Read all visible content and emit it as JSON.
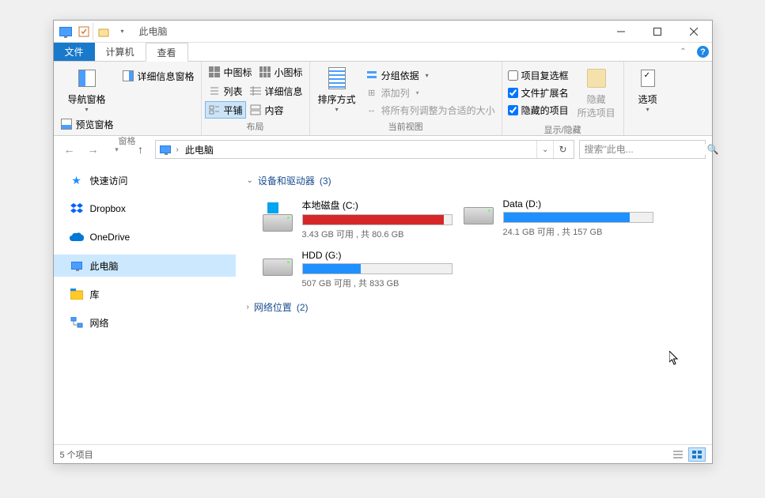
{
  "title": "此电脑",
  "ribbon": {
    "file": "文件",
    "computer": "计算机",
    "view": "查看",
    "panes": {
      "nav": "导航窗格",
      "preview": "预览窗格",
      "details": "详细信息窗格",
      "group": "窗格"
    },
    "layout": {
      "medium": "中图标",
      "small": "小图标",
      "list": "列表",
      "detail": "详细信息",
      "tiles": "平铺",
      "content": "内容",
      "group": "布局"
    },
    "current": {
      "sort": "排序方式",
      "groupby": "分组依据",
      "addcols": "添加列",
      "sizecols": "将所有列调整为合适的大小",
      "group": "当前视图"
    },
    "showhide": {
      "itemcheck": "项目复选框",
      "ext": "文件扩展名",
      "hidden": "隐藏的项目",
      "hidebtn": "隐藏",
      "hidebtn2": "所选项目",
      "group": "显示/隐藏"
    },
    "options": "选项"
  },
  "breadcrumb": {
    "current": "此电脑"
  },
  "search": {
    "placeholder": "搜索\"此电..."
  },
  "sidebar": {
    "quick": "快速访问",
    "dropbox": "Dropbox",
    "onedrive": "OneDrive",
    "thispc": "此电脑",
    "libraries": "库",
    "network": "网络"
  },
  "groups": {
    "drives": {
      "label": "设备和驱动器",
      "count": "(3)"
    },
    "netloc": {
      "label": "网络位置",
      "count": "(2)"
    }
  },
  "drives": [
    {
      "name": "本地磁盘 (C:)",
      "free": "3.43 GB 可用 , 共 80.6 GB",
      "pct": 95,
      "color": "red",
      "winlogo": true
    },
    {
      "name": "Data (D:)",
      "free": "24.1 GB 可用 , 共 157 GB",
      "pct": 85,
      "color": "blue",
      "winlogo": false
    },
    {
      "name": "HDD (G:)",
      "free": "507 GB 可用 , 共 833 GB",
      "pct": 39,
      "color": "blue",
      "winlogo": false
    }
  ],
  "status": {
    "items": "5 个项目"
  }
}
